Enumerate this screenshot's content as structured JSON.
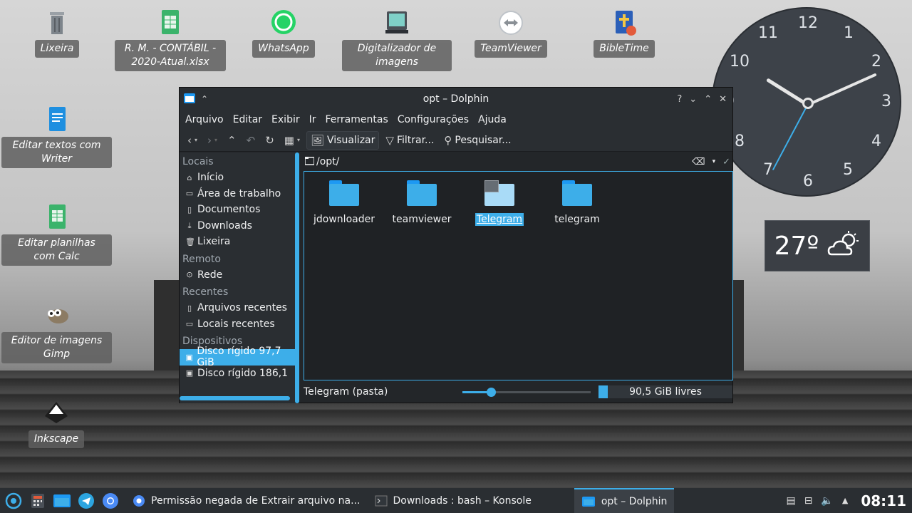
{
  "desktop": {
    "icons": [
      {
        "label": "Lixeira",
        "icon": "trash-icon"
      },
      {
        "label": "R. M. - CONTÁBIL - 2020-Atual.xlsx",
        "icon": "spreadsheet-icon"
      },
      {
        "label": "WhatsApp",
        "icon": "whatsapp-icon"
      },
      {
        "label": "Digitalizador de imagens",
        "icon": "scanner-icon"
      },
      {
        "label": "TeamViewer",
        "icon": "teamviewer-icon"
      },
      {
        "label": "BibleTime",
        "icon": "bible-icon"
      },
      {
        "label": "Editar textos com Writer",
        "icon": "writer-icon"
      },
      {
        "label": "Editar planilhas com Calc",
        "icon": "calc-icon"
      },
      {
        "label": "Editor de imagens Gimp",
        "icon": "gimp-icon"
      },
      {
        "label": "Inkscape",
        "icon": "inkscape-icon"
      }
    ]
  },
  "clock_widget": {
    "numbers": [
      "12",
      "1",
      "2",
      "3",
      "4",
      "5",
      "6",
      "7",
      "8",
      "9",
      "10",
      "11"
    ]
  },
  "weather": {
    "temp": "27º",
    "icon": "partly-cloudy-icon"
  },
  "dolphin": {
    "title": "opt – Dolphin",
    "menu": [
      "Arquivo",
      "Editar",
      "Exibir",
      "Ir",
      "Ferramentas",
      "Configurações",
      "Ajuda"
    ],
    "toolbar": {
      "view": "Visualizar",
      "filter": "Filtrar...",
      "search": "Pesquisar..."
    },
    "sidebar": {
      "sections": [
        {
          "header": "Locais",
          "items": [
            {
              "label": "Início",
              "icon": "home-icon"
            },
            {
              "label": "Área de trabalho",
              "icon": "desktop-icon"
            },
            {
              "label": "Documentos",
              "icon": "documents-icon"
            },
            {
              "label": "Downloads",
              "icon": "downloads-icon"
            },
            {
              "label": "Lixeira",
              "icon": "trash-icon"
            }
          ]
        },
        {
          "header": "Remoto",
          "items": [
            {
              "label": "Rede",
              "icon": "network-icon"
            }
          ]
        },
        {
          "header": "Recentes",
          "items": [
            {
              "label": "Arquivos recentes",
              "icon": "recent-files-icon"
            },
            {
              "label": "Locais recentes",
              "icon": "recent-places-icon"
            }
          ]
        },
        {
          "header": "Dispositivos",
          "items": [
            {
              "label": "Disco rígido 97,7 GiB",
              "icon": "harddisk-icon",
              "selected": true
            },
            {
              "label": "Disco rígido 186,1",
              "icon": "harddisk-icon"
            }
          ]
        }
      ]
    },
    "location": "/opt/",
    "files": [
      {
        "name": "jdownloader",
        "selected": false
      },
      {
        "name": "teamviewer",
        "selected": false
      },
      {
        "name": "Telegram",
        "selected": true
      },
      {
        "name": "telegram",
        "selected": false
      }
    ],
    "status": {
      "selection": "Telegram (pasta)",
      "zoom_fraction": 0.22,
      "free_space": "90,5 GiB livres",
      "used_fraction": 0.07
    }
  },
  "taskbar": {
    "tasks": [
      {
        "label": "Permissão negada de Extrair arquivo na...",
        "icon": "chromium-icon",
        "active": false
      },
      {
        "label": "Downloads : bash – Konsole",
        "icon": "konsole-icon",
        "active": false
      },
      {
        "label": "opt – Dolphin",
        "icon": "dolphin-icon",
        "active": true
      }
    ],
    "time": "08:11"
  }
}
